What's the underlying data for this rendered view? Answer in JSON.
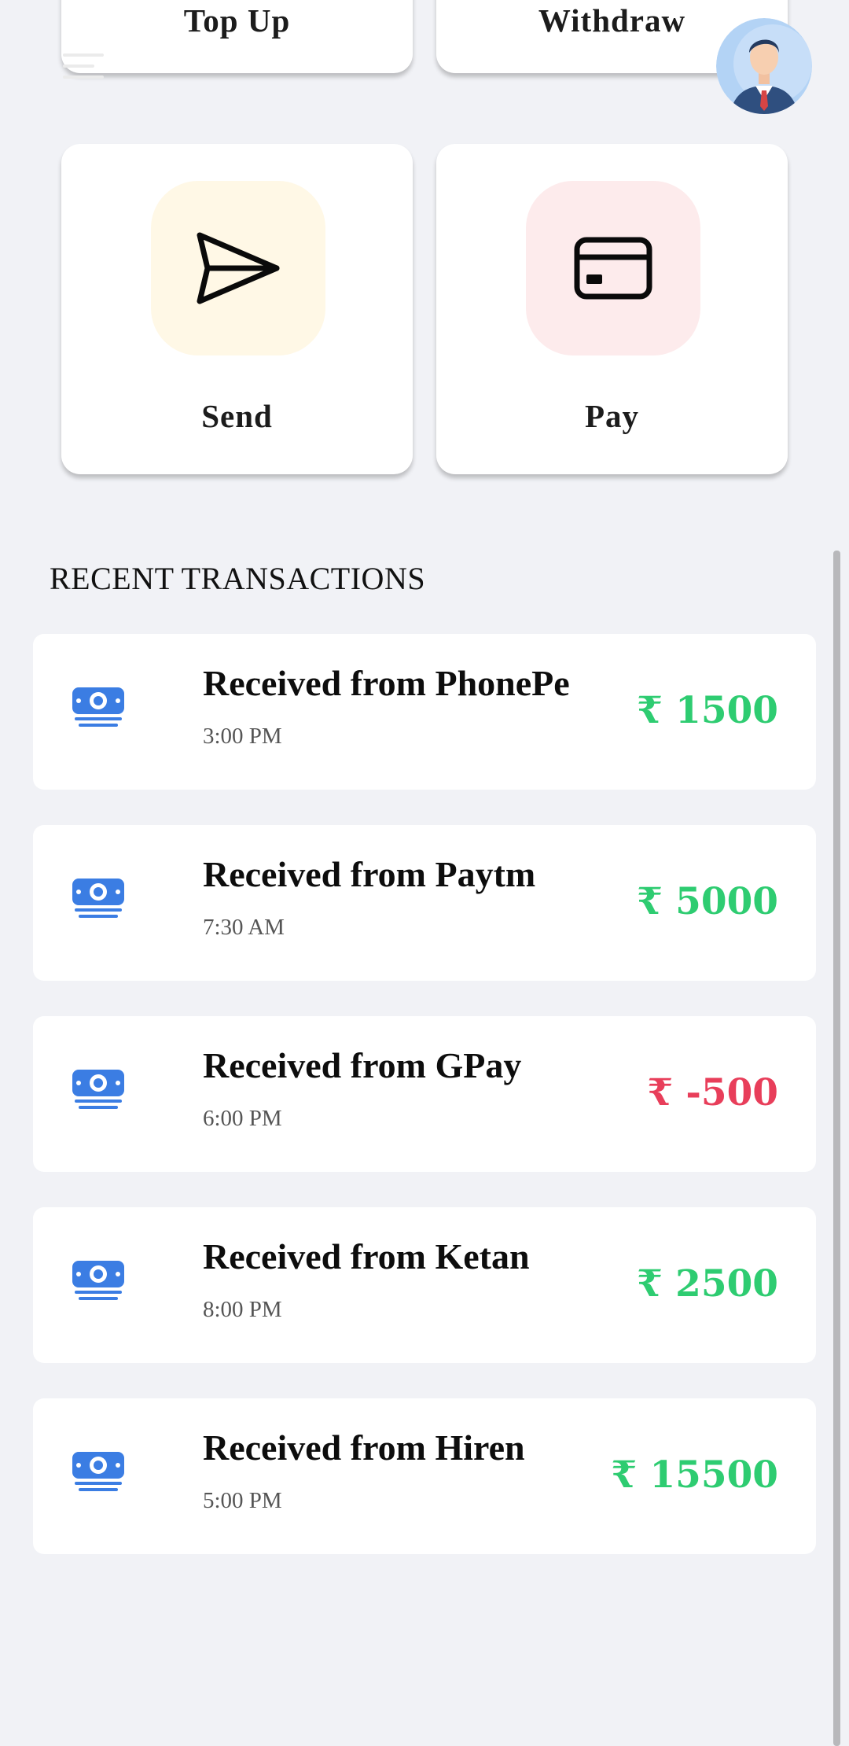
{
  "actions_top": [
    {
      "label": "Top Up"
    },
    {
      "label": "Withdraw"
    }
  ],
  "actions": [
    {
      "label": "Send",
      "icon": "send-icon",
      "tile_color": "#fff8e6"
    },
    {
      "label": "Pay",
      "icon": "credit-card-icon",
      "tile_color": "#fdebec"
    }
  ],
  "section_title": "RECENT TRANSACTIONS",
  "colors": {
    "positive": "#2ecc71",
    "negative": "#e83e5a",
    "icon_blue": "#3b7de3",
    "background": "#f1f2f6"
  },
  "transactions": [
    {
      "title": "Received from PhonePe",
      "time": "3:00 PM",
      "amount": "₹ 1500",
      "direction": "positive",
      "icon": "cash-icon"
    },
    {
      "title": "Received from Paytm",
      "time": "7:30 AM",
      "amount": "₹ 5000",
      "direction": "positive",
      "icon": "cash-icon"
    },
    {
      "title": "Received from GPay",
      "time": "6:00 PM",
      "amount": "₹ -500",
      "direction": "negative",
      "icon": "cash-icon"
    },
    {
      "title": "Received from Ketan",
      "time": "8:00 PM",
      "amount": "₹ 2500",
      "direction": "positive",
      "icon": "cash-icon"
    },
    {
      "title": "Received from Hiren",
      "time": "5:00 PM",
      "amount": "₹ 15500",
      "direction": "positive",
      "icon": "cash-icon"
    }
  ]
}
